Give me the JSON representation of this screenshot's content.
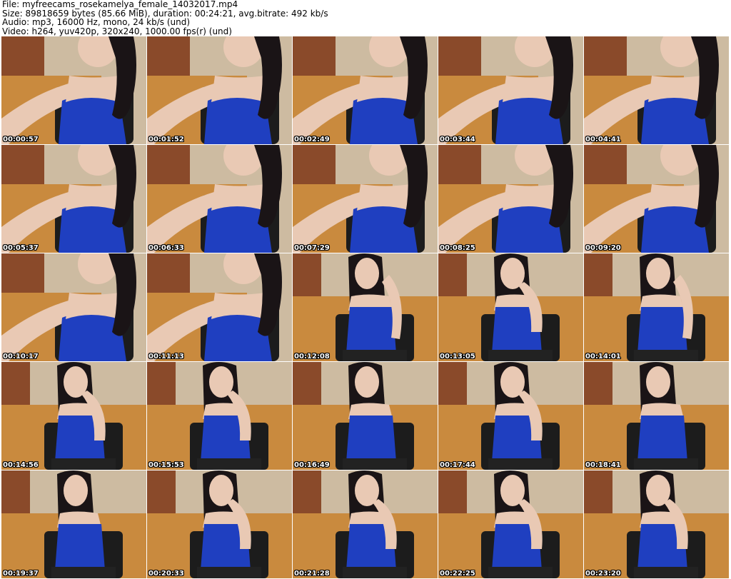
{
  "header": {
    "file_line": "File: myfreecams_rosekamelya_female_14032017.mp4",
    "size_line": "Size: 89818659 bytes (85.66 MiB), duration: 00:24:21, avg.bitrate: 492 kb/s",
    "audio_line": "Audio: mp3, 16000 Hz, mono, 24 kb/s (und)",
    "video_line": "Video: h264, yuv420p, 320x240, 1000.00 fps(r) (und)"
  },
  "colors": {
    "wall": "#cdbba1",
    "floor": "#c98a3e",
    "door": "#8a4a2a",
    "skin": "#e9c9b4",
    "hair": "#1a1416",
    "top": "#1f3fc0",
    "chair": "#1c1c1c",
    "pants": "#222222"
  },
  "thumbnails": [
    {
      "timestamp": "00:00:57",
      "scene": "closeup"
    },
    {
      "timestamp": "00:01:52",
      "scene": "closeup"
    },
    {
      "timestamp": "00:02:49",
      "scene": "closeup"
    },
    {
      "timestamp": "00:03:44",
      "scene": "closeup"
    },
    {
      "timestamp": "00:04:41",
      "scene": "closeup"
    },
    {
      "timestamp": "00:05:37",
      "scene": "closeup"
    },
    {
      "timestamp": "00:06:33",
      "scene": "closeup"
    },
    {
      "timestamp": "00:07:29",
      "scene": "closeup"
    },
    {
      "timestamp": "00:08:25",
      "scene": "closeup"
    },
    {
      "timestamp": "00:09:20",
      "scene": "closeup"
    },
    {
      "timestamp": "00:10:17",
      "scene": "closeup"
    },
    {
      "timestamp": "00:11:13",
      "scene": "closeup"
    },
    {
      "timestamp": "00:12:08",
      "scene": "seated-wide"
    },
    {
      "timestamp": "00:13:05",
      "scene": "seated-hand"
    },
    {
      "timestamp": "00:14:01",
      "scene": "seated-wide"
    },
    {
      "timestamp": "00:14:56",
      "scene": "seated-hand"
    },
    {
      "timestamp": "00:15:53",
      "scene": "seated-hand"
    },
    {
      "timestamp": "00:16:49",
      "scene": "seated-front"
    },
    {
      "timestamp": "00:17:44",
      "scene": "seated-hand"
    },
    {
      "timestamp": "00:18:41",
      "scene": "seated-front"
    },
    {
      "timestamp": "00:19:37",
      "scene": "seated-front"
    },
    {
      "timestamp": "00:20:33",
      "scene": "seated-hand"
    },
    {
      "timestamp": "00:21:28",
      "scene": "seated-hand"
    },
    {
      "timestamp": "00:22:25",
      "scene": "seated-hand"
    },
    {
      "timestamp": "00:23:20",
      "scene": "seated-hand"
    }
  ]
}
